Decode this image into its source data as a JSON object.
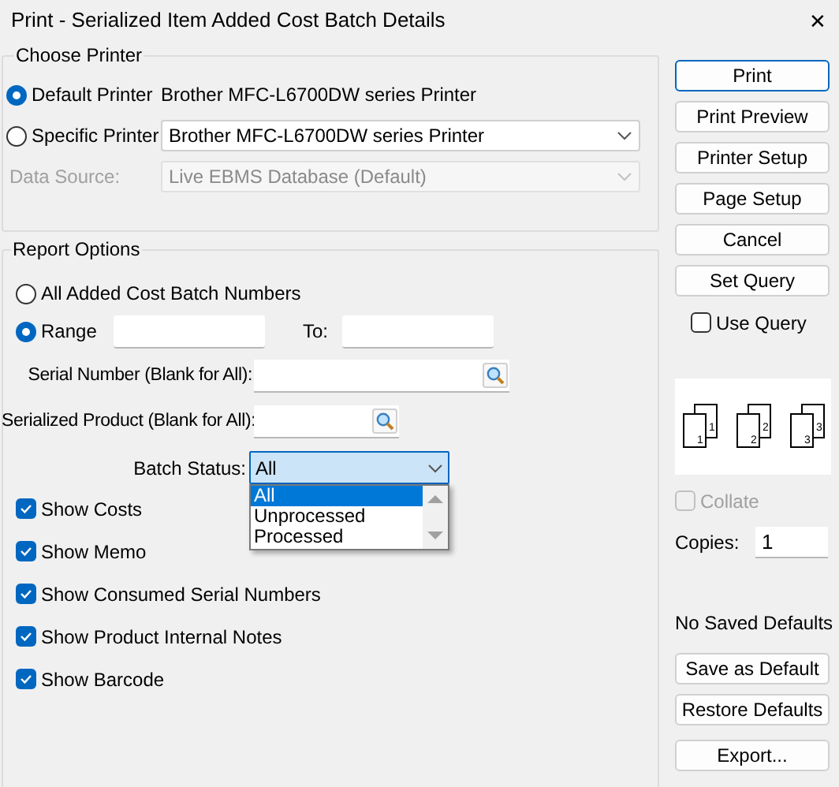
{
  "window": {
    "title": "Print - Serialized Item Added Cost Batch Details",
    "close": "✕"
  },
  "choose_printer": {
    "title": "Choose Printer",
    "options": [
      {
        "label": "Default Printer",
        "selected": true,
        "kind": "text",
        "value": "Brother MFC-L6700DW series Printer"
      },
      {
        "label": "Specific Printer",
        "selected": false,
        "kind": "select",
        "value": "Brother MFC-L6700DW series Printer"
      }
    ],
    "data_source": {
      "label": "Data Source:",
      "value": "Live EBMS Database (Default)",
      "disabled": true
    }
  },
  "report_options": {
    "title": "Report Options",
    "scope": [
      {
        "label": "All Added Cost Batch Numbers",
        "selected": false
      },
      {
        "label": "Range",
        "selected": true,
        "to_label": "To:"
      }
    ],
    "serial_number": {
      "label": "Serial Number (Blank for All):"
    },
    "serialized_product": {
      "label": "Serialized Product (Blank for All):"
    },
    "batch_status": {
      "label": "Batch Status:",
      "value": "All",
      "expanded": true,
      "options": [
        {
          "label": "All",
          "selected": true
        },
        {
          "label": "Unprocessed",
          "selected": false
        },
        {
          "label": "Processed",
          "selected": false
        }
      ]
    },
    "checkboxes": [
      {
        "label": "Show Costs",
        "checked": true
      },
      {
        "label": "Show Memo",
        "checked": true
      },
      {
        "label": "Show Consumed Serial Numbers",
        "checked": true
      },
      {
        "label": "Show Product Internal Notes",
        "checked": true
      },
      {
        "label": "Show Barcode",
        "checked": true
      }
    ]
  },
  "actions": [
    {
      "label": "Print",
      "default": true
    },
    {
      "label": "Print Preview",
      "default": false
    },
    {
      "label": "Printer Setup",
      "default": false
    },
    {
      "label": "Page Setup",
      "default": false
    },
    {
      "label": "Cancel",
      "default": false
    },
    {
      "label": "Set Query",
      "default": false
    }
  ],
  "use_query": {
    "label": "Use Query",
    "checked": false
  },
  "collate_pages": [
    {
      "back": "1",
      "front": "1"
    },
    {
      "back": "2",
      "front": "2"
    },
    {
      "back": "3",
      "front": "3"
    }
  ],
  "collate": {
    "label": "Collate",
    "checked": false,
    "disabled": true
  },
  "copies": {
    "label": "Copies:",
    "value": "1"
  },
  "defaults_status": "No Saved Defaults",
  "default_actions": [
    {
      "label": "Save as Default"
    },
    {
      "label": "Restore Defaults"
    },
    {
      "label": "Export..."
    }
  ]
}
